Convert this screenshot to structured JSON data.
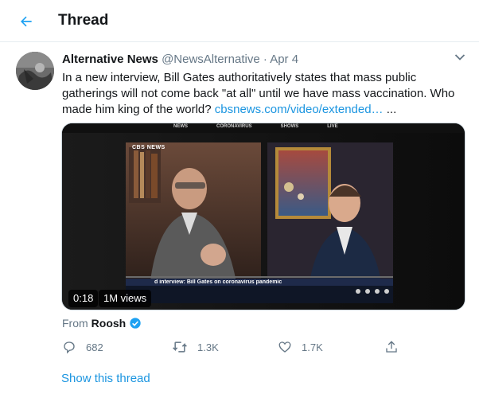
{
  "header": {
    "title": "Thread",
    "back_icon": "arrow-left-icon"
  },
  "tweet": {
    "author_name": "Alternative News",
    "handle": "@NewsAlternative",
    "separator": "·",
    "date": "Apr 4",
    "text": "In a new interview, Bill Gates authoritatively states that mass public gatherings will not come back \"at all\" until we have mass vaccination. Who made him king of the world?",
    "link_text": "cbsnews.com/video/extended…",
    "ellipsis": "...",
    "media": {
      "duration": "0:18",
      "views": "1M views",
      "network_logo": "CBS NEWS",
      "nav_items": [
        "NEWS",
        "CORONAVIRUS",
        "SHOWS",
        "LIVE"
      ],
      "caption_headline": "d interview: Bill Gates on coronavirus pandemic"
    },
    "from_label": "From",
    "from_name": "Roosh",
    "actions": {
      "reply_count": "682",
      "retweet_count": "1.3K",
      "like_count": "1.7K"
    }
  },
  "show_thread_label": "Show this thread",
  "colors": {
    "accent": "#1da1f2",
    "link": "#1b95e0",
    "secondary_text": "#657786",
    "verified": "#1da1f2"
  }
}
